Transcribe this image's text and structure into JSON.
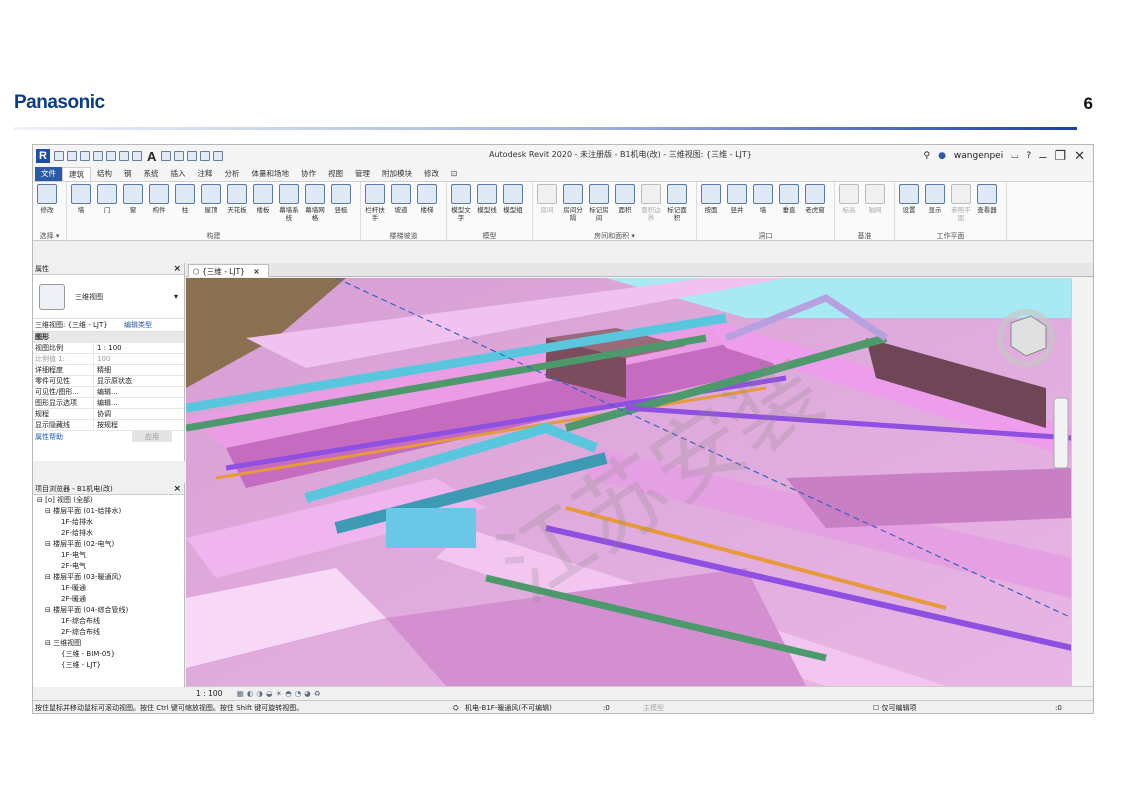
{
  "slide": {
    "brand": "Panasonic",
    "page_number": "6",
    "brand_color": "#0b3c8a"
  },
  "window": {
    "title": "Autodesk Revit 2020 - 未注册版 - B1机电(改) - 三维视图: {三维 - LJT}",
    "user": "wangenpei",
    "help": "?",
    "sign_in_icon": "user-icon"
  },
  "menu_tabs": [
    "文件",
    "建筑",
    "结构",
    "钢",
    "系统",
    "插入",
    "注释",
    "分析",
    "体量和场地",
    "协作",
    "视图",
    "管理",
    "附加模块",
    "修改",
    "⊡"
  ],
  "ribbon": {
    "groups": [
      {
        "label": "选择 ▾",
        "buttons": [
          "修改"
        ]
      },
      {
        "label": "构建",
        "buttons": [
          "墙",
          "门",
          "窗",
          "构件",
          "柱",
          "屋顶",
          "天花板",
          "楼板",
          "幕墙系统",
          "幕墙网格",
          "竖梃"
        ]
      },
      {
        "label": "楼梯坡道",
        "buttons": [
          "栏杆扶手",
          "坡道",
          "楼梯"
        ]
      },
      {
        "label": "模型",
        "buttons": [
          "模型文字",
          "模型线",
          "模型组"
        ]
      },
      {
        "label": "房间和面积 ▾",
        "buttons": [
          "房间",
          "房间分隔",
          "标记房间",
          "面积",
          "面积边界",
          "标记面积"
        ],
        "disabled": [
          0,
          4
        ]
      },
      {
        "label": "洞口",
        "buttons": [
          "按面",
          "竖井",
          "墙",
          "垂直",
          "老虎窗"
        ]
      },
      {
        "label": "基准",
        "buttons": [
          "标高",
          "轴网"
        ],
        "disabled": [
          0,
          1
        ]
      },
      {
        "label": "工作平面",
        "buttons": [
          "设置",
          "显示",
          "参照平面",
          "查看器"
        ],
        "disabled": [
          2
        ]
      }
    ]
  },
  "properties": {
    "header": "属性",
    "type_name": "三维视图",
    "type_selector": "三维视图: {三维 - LJT}",
    "edit_type": "编辑类型",
    "category": "图形",
    "rows": [
      {
        "k": "视图比例",
        "v": "1 : 100"
      },
      {
        "k": "比例值 1:",
        "v": "100",
        "gray": true
      },
      {
        "k": "详细程度",
        "v": "精细"
      },
      {
        "k": "零件可见性",
        "v": "显示原状态"
      },
      {
        "k": "可见性/图形...",
        "v": "编辑..."
      },
      {
        "k": "图形显示选项",
        "v": "编辑..."
      },
      {
        "k": "规程",
        "v": "协调"
      },
      {
        "k": "显示隐藏线",
        "v": "按规程"
      }
    ],
    "help": "属性帮助",
    "apply": "应用"
  },
  "browser": {
    "header": "项目浏览器 - B1机电(改)",
    "items": [
      {
        "text": "⊟ [o] 视图 (全部)",
        "indent": 0
      },
      {
        "text": "⊟ 楼层平面 (01-给排水)",
        "indent": 1
      },
      {
        "text": "1F-给排水",
        "indent": 3
      },
      {
        "text": "2F-给排水",
        "indent": 3
      },
      {
        "text": "⊟ 楼层平面 (02-电气)",
        "indent": 1
      },
      {
        "text": "1F-电气",
        "indent": 3
      },
      {
        "text": "2F-电气",
        "indent": 3
      },
      {
        "text": "⊟ 楼层平面 (03-暖通风)",
        "indent": 1
      },
      {
        "text": "1F-暖通",
        "indent": 3
      },
      {
        "text": "2F-暖通",
        "indent": 3
      },
      {
        "text": "⊟ 楼层平面 (04-综合管线)",
        "indent": 1
      },
      {
        "text": "1F-综合布线",
        "indent": 3
      },
      {
        "text": "2F-综合布线",
        "indent": 3
      },
      {
        "text": "⊟ 三维视图",
        "indent": 1
      },
      {
        "text": "{三维 - BIM-05}",
        "indent": 3
      },
      {
        "text": "{三维 - LJT}",
        "indent": 3
      }
    ]
  },
  "view": {
    "tab": "{三维 - LJT}",
    "scale": "1 : 100",
    "watermark": "江苏安装"
  },
  "status": {
    "hint": "按住鼠标并移动鼠标可滚动视图。按住 Ctrl 键可缩放视图。按住 Shift 键可旋转视图。",
    "workset": "机电-B1F-暖通风(不可编辑)",
    "count": ":0",
    "model": "主模型",
    "editable_only": "仅可编辑项",
    "filter": ":0"
  },
  "colors": {
    "pink": "#e9a8e6",
    "magenta": "#c978c7",
    "pipe_cyan": "#58c6dc",
    "pipe_green": "#4c9a6c",
    "pipe_purple": "#8f4fe0",
    "pipe_orange": "#e79a3a",
    "duct_brown": "#8a5560"
  }
}
